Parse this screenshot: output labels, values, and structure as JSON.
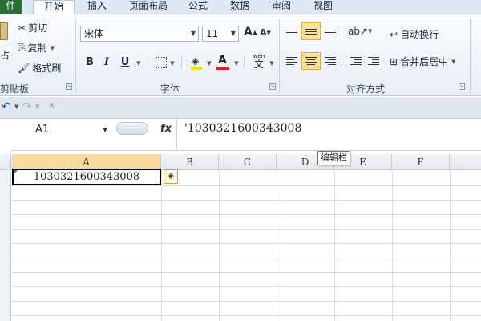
{
  "tabs": {
    "file": "件",
    "home": "开始",
    "insert": "插入",
    "page_layout": "页面布局",
    "formulas": "公式",
    "data": "数据",
    "review": "审阅",
    "view": "视图"
  },
  "clipboard": {
    "paste_fragment": "占",
    "cut": "剪切",
    "copy": "复制",
    "format_painter": "格式刷",
    "label": "剪贴板"
  },
  "font": {
    "family": "宋体",
    "size": "11",
    "grow": "A",
    "shrink": "A",
    "bold": "B",
    "italic": "I",
    "underline": "U",
    "font_color_letter": "A",
    "phonetic": "wén",
    "phonetic_char": "文",
    "label": "字体"
  },
  "alignment": {
    "wrap_text": "自动换行",
    "merge_center": "合并后居中",
    "label": "对齐方式"
  },
  "formula_bar": {
    "name_box": "A1",
    "fx": "fx",
    "content": "'1030321600343008"
  },
  "sheet": {
    "columns": [
      "A",
      "B",
      "C",
      "D",
      "E",
      "F"
    ],
    "cell_a1": "1030321600343008",
    "tooltip": "编辑栏",
    "warning_symbol": "◈"
  },
  "colors": {
    "file_tab": "#2c6c38",
    "active_highlight": "#fbe19a",
    "selected_column": "#f9d99f",
    "font_color_bar": "#e02020",
    "fill_color_bar": "#f5e600"
  }
}
